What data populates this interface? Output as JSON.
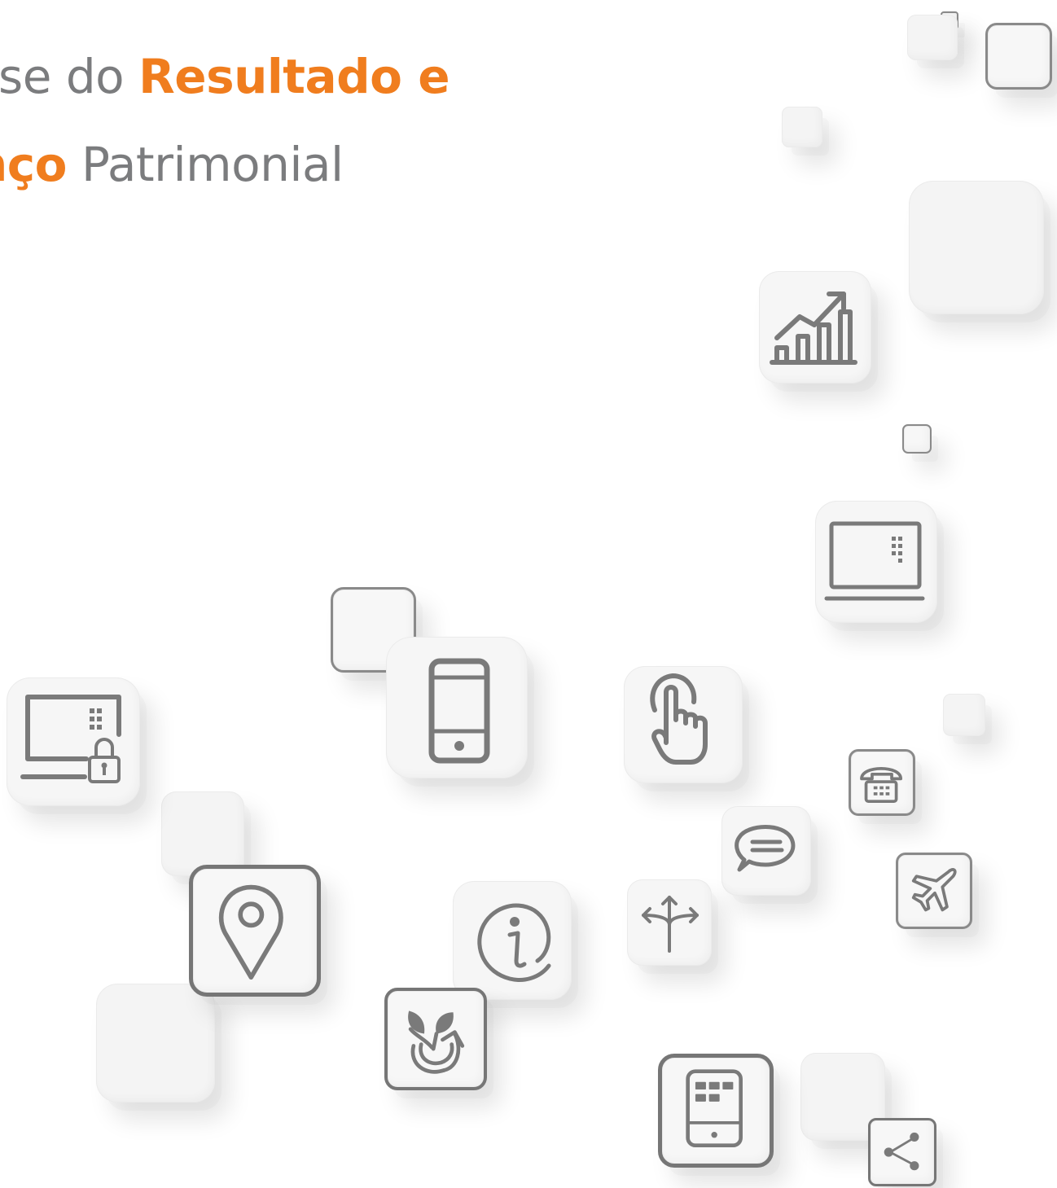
{
  "title": {
    "line1_prefix": "se do ",
    "line1_highlight": "Resultado e",
    "line2_highlight": "nço",
    "line2_suffix": " Patrimonial"
  },
  "colors": {
    "accent": "#f07d1e",
    "text": "#7b7c7e",
    "icon": "#7a7a7a",
    "background": "#ffffff"
  },
  "icons": [
    "chart-growth-icon",
    "laptop-icon",
    "laptop-lock-icon",
    "smartphone-icon",
    "touch-hand-icon",
    "phone-icon",
    "chat-icon",
    "airplane-icon",
    "location-pin-icon",
    "info-icon",
    "directions-icon",
    "eco-refresh-icon",
    "tablet-icon",
    "share-icon"
  ]
}
